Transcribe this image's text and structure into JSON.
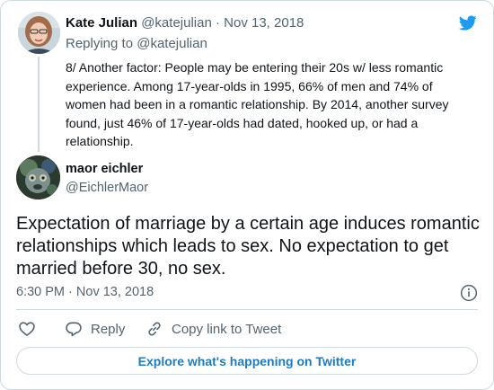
{
  "parent_tweet": {
    "author_name": "Kate Julian",
    "author_handle": "@katejulian",
    "separator": "·",
    "date": "Nov 13, 2018",
    "replying_to_prefix": "Replying to",
    "replying_to_handle": "@katejulian",
    "text": "8/ Another factor: People may be entering their 20s w/ less romantic experience. Among 17-year-olds in 1995, 66% of men and 74% of women had been in a romantic relationship. By 2014, another survey found, just 46% of 17-year-olds had dated, hooked up, or had a relationship."
  },
  "main_tweet": {
    "author_name": "maor eichler",
    "author_handle": "@EichlerMaor",
    "text": "Expectation of marriage by a certain age induces romantic relationships which leads to sex. No expectation to get married before 30, no sex.",
    "time": "6:30 PM",
    "separator": "·",
    "date": "Nov 13, 2018"
  },
  "actions": {
    "reply_label": "Reply",
    "copy_link_label": "Copy link to Tweet"
  },
  "explore_label": "Explore what's happening on Twitter",
  "icons": {
    "brand": "twitter-bird-icon",
    "info": "info-icon",
    "like": "heart-icon",
    "reply": "speech-bubble-icon",
    "copy": "link-icon"
  },
  "colors": {
    "twitter_blue": "#1d9bf0",
    "link_blue": "#1d7bc2",
    "muted_text": "#536471",
    "border": "#cfd9de"
  }
}
